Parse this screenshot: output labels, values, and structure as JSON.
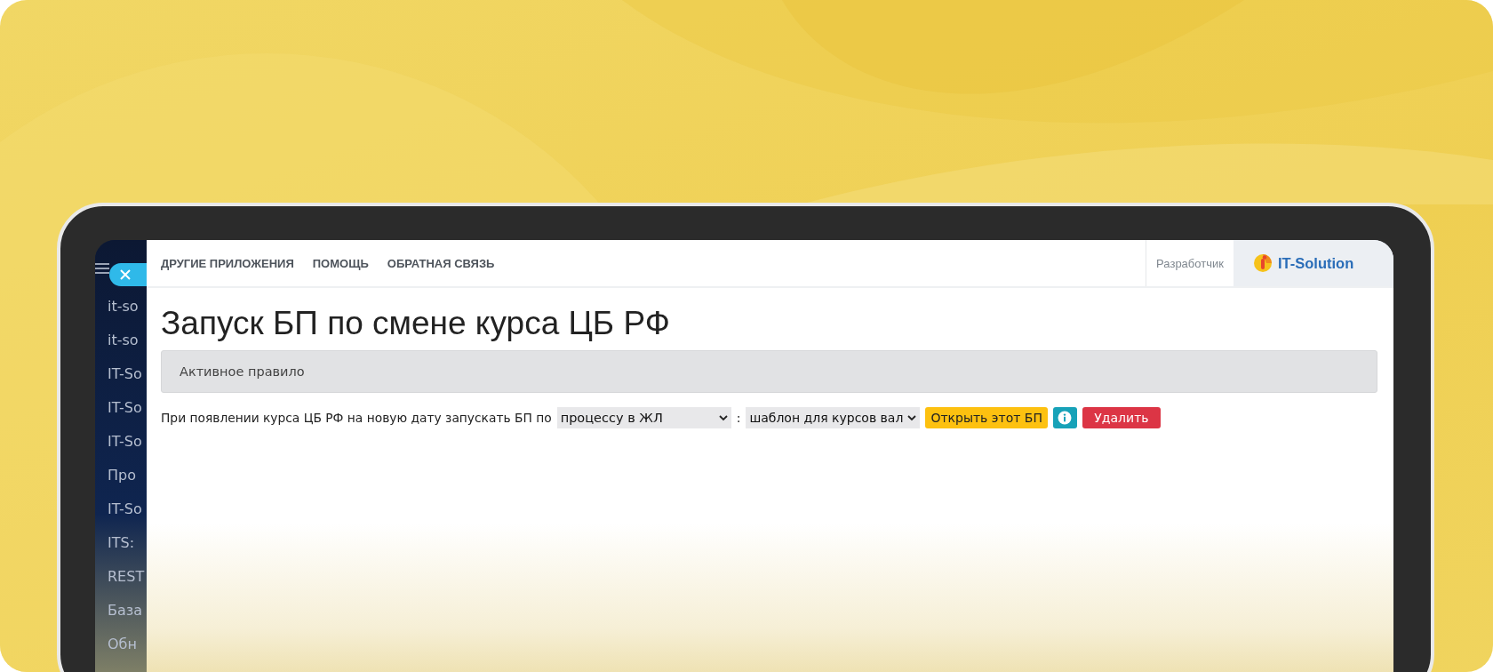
{
  "header": {
    "nav": [
      "ДРУГИЕ ПРИЛОЖЕНИЯ",
      "ПОМОЩЬ",
      "ОБРАТНАЯ СВЯЗЬ"
    ],
    "role": "Разработчик",
    "brand": "IT-Solution"
  },
  "sidebar": {
    "items": [
      "it-so",
      "it-so",
      "IT-So",
      "IT-So",
      "IT-So",
      "Про",
      "IT-So",
      "ITS:",
      "REST",
      "База",
      "Обн"
    ]
  },
  "title": "Запуск БП по смене курса ЦБ РФ",
  "panel_heading": "Активное правило",
  "rule": {
    "text": "При появлении курса ЦБ РФ на новую дату запускать БП по",
    "process_select": {
      "value": "процессу в ЖЛ"
    },
    "separator": ":",
    "template_select": {
      "value": "шаблон для курсов вал"
    },
    "buttons": [
      {
        "kind": "warning",
        "label": "Открыть этот БП"
      },
      {
        "kind": "info"
      },
      {
        "kind": "danger",
        "label": "Удалить"
      }
    ]
  }
}
